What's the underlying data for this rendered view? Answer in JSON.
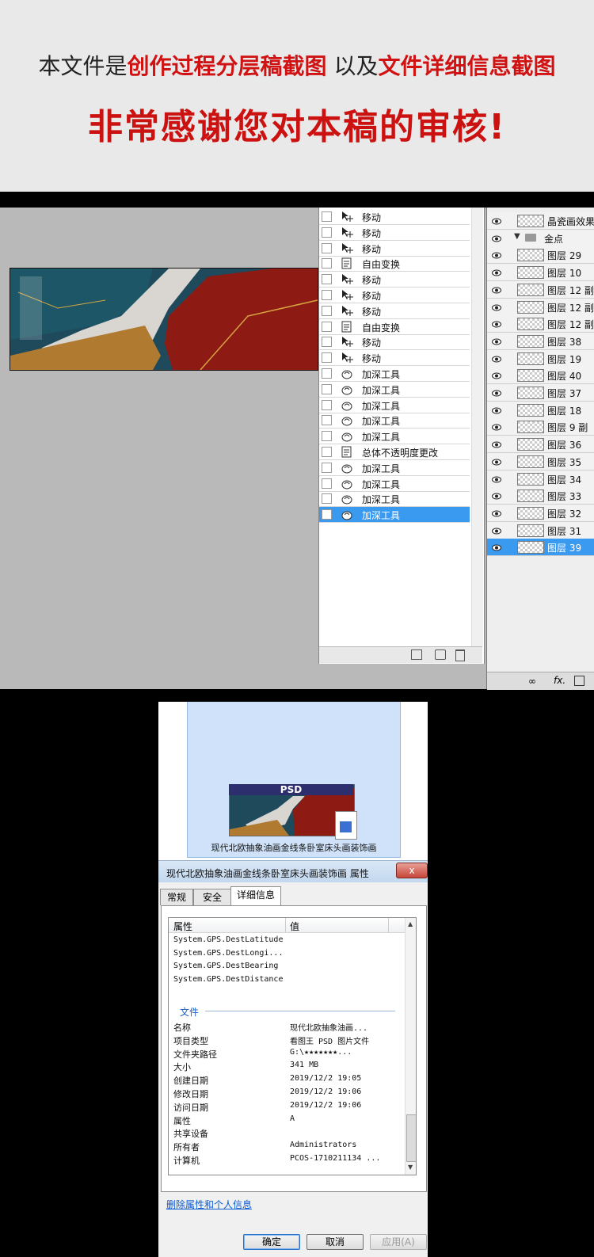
{
  "header": {
    "line1_part1": "本文件是",
    "line1_part2": "创作过程分层稿截图",
    "line1_part3": " 以及",
    "line1_part4": "文件详细信息截图",
    "line2": "非常感谢您对本稿的审核!"
  },
  "history": {
    "items": [
      {
        "label": "移动",
        "icon": "move-tool-icon"
      },
      {
        "label": "移动",
        "icon": "move-tool-icon"
      },
      {
        "label": "移动",
        "icon": "move-tool-icon"
      },
      {
        "label": "自由变换",
        "icon": "transform-icon"
      },
      {
        "label": "移动",
        "icon": "move-tool-icon"
      },
      {
        "label": "移动",
        "icon": "move-tool-icon"
      },
      {
        "label": "移动",
        "icon": "move-tool-icon"
      },
      {
        "label": "自由变换",
        "icon": "transform-icon"
      },
      {
        "label": "移动",
        "icon": "move-tool-icon"
      },
      {
        "label": "移动",
        "icon": "move-tool-icon"
      },
      {
        "label": "加深工具",
        "icon": "burn-tool-icon"
      },
      {
        "label": "加深工具",
        "icon": "burn-tool-icon"
      },
      {
        "label": "加深工具",
        "icon": "burn-tool-icon"
      },
      {
        "label": "加深工具",
        "icon": "burn-tool-icon"
      },
      {
        "label": "加深工具",
        "icon": "burn-tool-icon"
      },
      {
        "label": "总体不透明度更改",
        "icon": "transform-icon"
      },
      {
        "label": "加深工具",
        "icon": "burn-tool-icon"
      },
      {
        "label": "加深工具",
        "icon": "burn-tool-icon"
      },
      {
        "label": "加深工具",
        "icon": "burn-tool-icon"
      },
      {
        "label": "加深工具",
        "icon": "burn-tool-icon",
        "selected": true
      }
    ]
  },
  "layers": {
    "items": [
      {
        "name": "晶瓷画效果",
        "group": false
      },
      {
        "name": "金点",
        "group": true
      },
      {
        "name": "图层 29"
      },
      {
        "name": "图层 10"
      },
      {
        "name": "图层 12 副本"
      },
      {
        "name": "图层 12 副本"
      },
      {
        "name": "图层 12 副本"
      },
      {
        "name": "图层 38"
      },
      {
        "name": "图层 19"
      },
      {
        "name": "图层 40"
      },
      {
        "name": "图层 37"
      },
      {
        "name": "图层 18"
      },
      {
        "name": "图层 9 副"
      },
      {
        "name": "图层 36"
      },
      {
        "name": "图层 35"
      },
      {
        "name": "图层 34"
      },
      {
        "name": "图层 33"
      },
      {
        "name": "图层 32"
      },
      {
        "name": "图层 31"
      },
      {
        "name": "图层 39",
        "selected": true
      }
    ],
    "footer": "fx."
  },
  "preview": {
    "badge": "PSD",
    "caption": "现代北欧抽象油画金线条卧室床头画装饰画"
  },
  "dialog": {
    "title": "现代北欧抽象油画金线条卧室床头画装饰画 属性",
    "close": "x",
    "tabs": [
      "常规",
      "安全",
      "详细信息"
    ],
    "active_tab": "详细信息",
    "col_property": "属性",
    "col_value": "值",
    "gps_rows": [
      "System.GPS.DestLatitude",
      "System.GPS.DestLongi...",
      "System.GPS.DestBearing",
      "System.GPS.DestDistance"
    ],
    "group_label": "文件",
    "rows": [
      {
        "k": "名称",
        "v": "现代北欧抽象油画..."
      },
      {
        "k": "项目类型",
        "v": "看图王 PSD 图片文件"
      },
      {
        "k": "文件夹路径",
        "v": "G:\\★★★★★★★..."
      },
      {
        "k": "大小",
        "v": "341 MB"
      },
      {
        "k": "创建日期",
        "v": "2019/12/2 19:05"
      },
      {
        "k": "修改日期",
        "v": "2019/12/2 19:06"
      },
      {
        "k": "访问日期",
        "v": "2019/12/2 19:06"
      },
      {
        "k": "属性",
        "v": "A"
      },
      {
        "k": "共享设备",
        "v": ""
      },
      {
        "k": "所有者",
        "v": "Administrators"
      },
      {
        "k": "计算机",
        "v": "PCOS-1710211134 ..."
      }
    ],
    "remove_link": "删除属性和个人信息",
    "ok": "确定",
    "cancel": "取消",
    "apply": "应用(A)"
  }
}
